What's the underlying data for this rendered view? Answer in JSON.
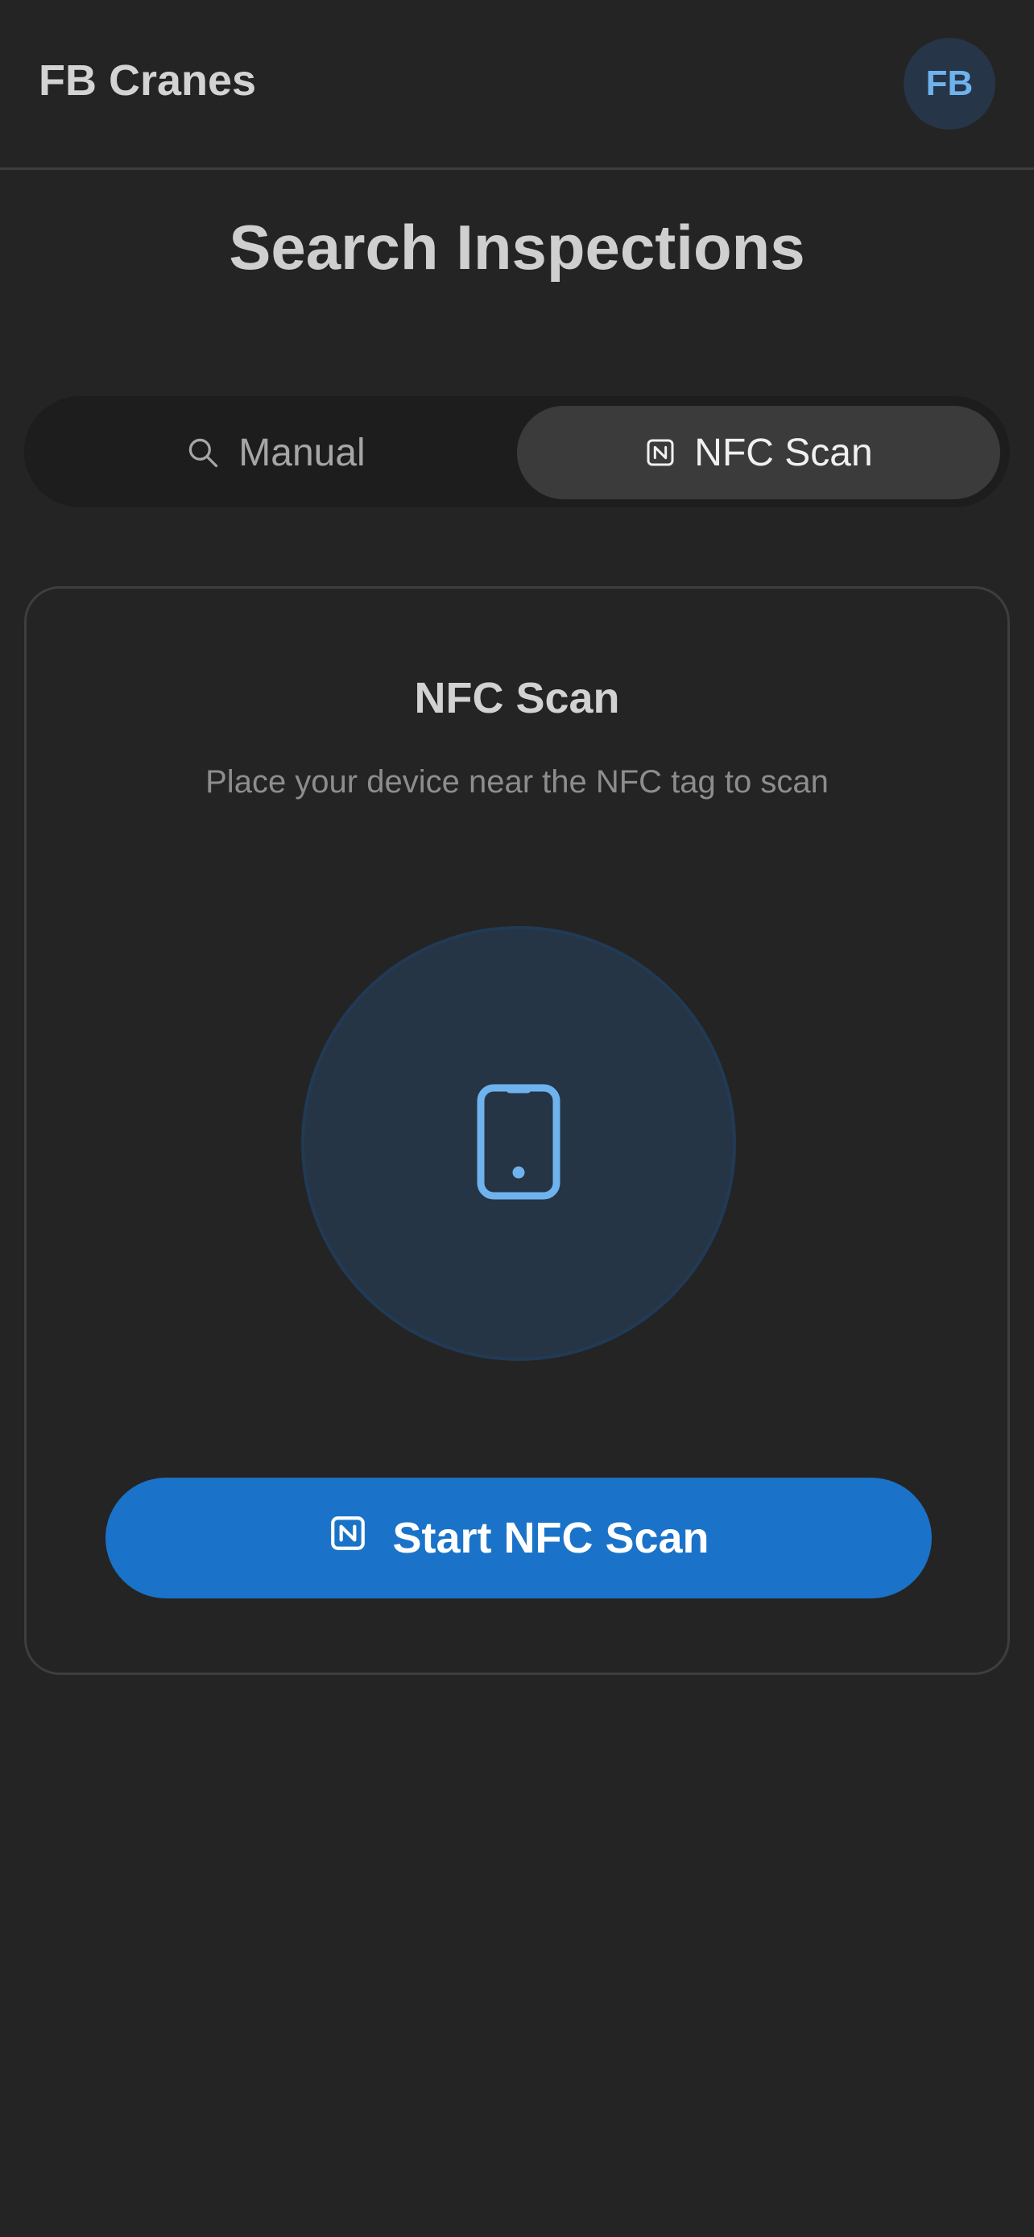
{
  "header": {
    "brand": "FB Cranes",
    "avatar_initials": "FB"
  },
  "page": {
    "title": "Search Inspections"
  },
  "tabs": {
    "manual": {
      "label": "Manual",
      "icon": "search-icon",
      "selected": false
    },
    "nfc": {
      "label": "NFC Scan",
      "icon": "nfc-icon",
      "selected": true
    }
  },
  "nfc_card": {
    "title": "NFC Scan",
    "subtitle": "Place your device near the NFC tag to scan",
    "illustration_icon": "smartphone-icon",
    "button_label": "Start NFC Scan",
    "button_icon": "nfc-icon"
  },
  "colors": {
    "background": "#242424",
    "accent": "#1a73c8",
    "icon_blue": "#6fb3ee"
  }
}
